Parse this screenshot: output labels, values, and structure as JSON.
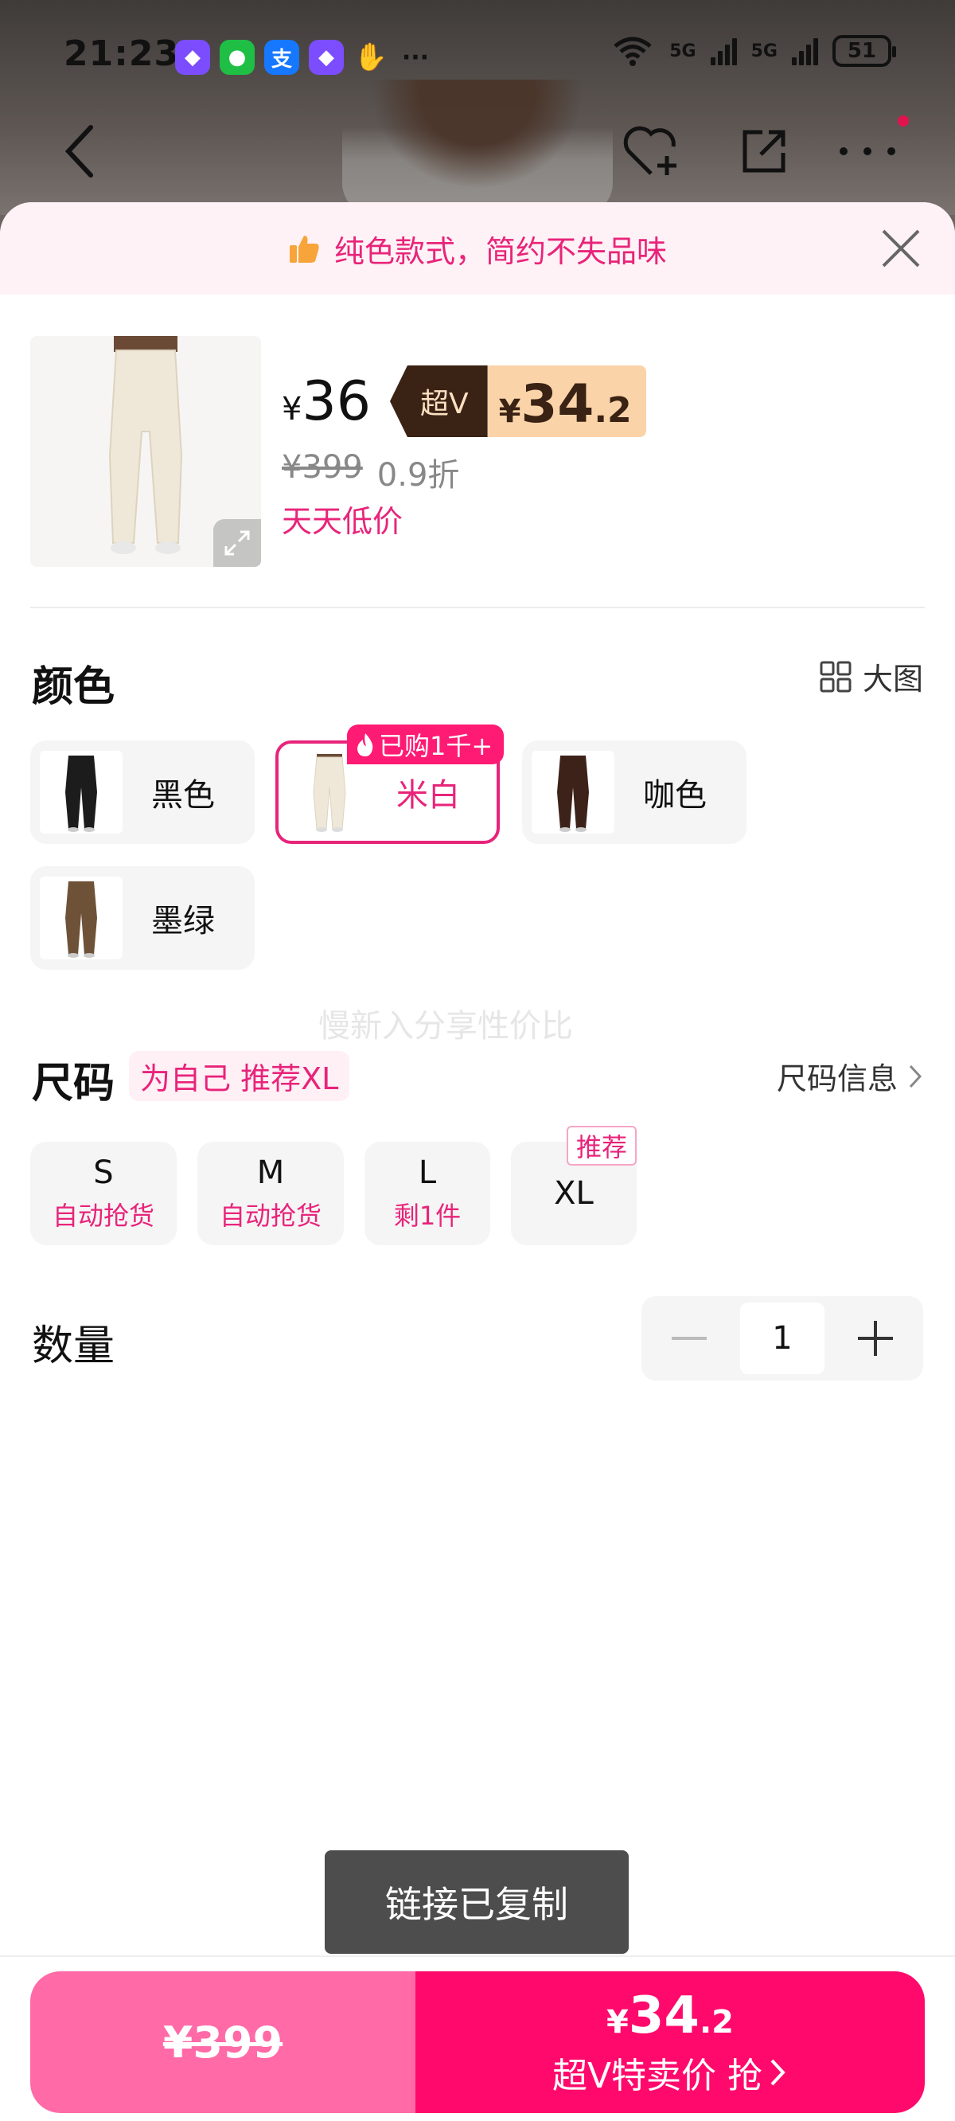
{
  "status_bar": {
    "time": "21:23",
    "network_1": "5G",
    "network_2": "5G",
    "battery": "51"
  },
  "promo": {
    "text": "纯色款式，简约不失品味"
  },
  "product": {
    "price": "36",
    "currency": "¥",
    "super_v_tag": "超V",
    "super_v_price_int": "34",
    "super_v_price_dec": ".2",
    "original_price": "¥399",
    "discount": "0.9折",
    "daily_low": "天天低价"
  },
  "color_section": {
    "title": "颜色",
    "big_image_label": "大图",
    "options": [
      {
        "label": "黑色",
        "selected": false
      },
      {
        "label": "米白",
        "selected": true,
        "badge": "已购1千+"
      },
      {
        "label": "咖色",
        "selected": false
      },
      {
        "label": "墨绿",
        "selected": false
      }
    ]
  },
  "watermark": "慢新入分享性价比",
  "size_section": {
    "title": "尺码",
    "recommend_tag": "为自己 推荐XL",
    "info_link": "尺码信息",
    "options": [
      {
        "name": "S",
        "sub": "自动抢货"
      },
      {
        "name": "M",
        "sub": "自动抢货"
      },
      {
        "name": "L",
        "sub": "剩1件"
      },
      {
        "name": "XL",
        "sub": "",
        "badge": "推荐"
      }
    ]
  },
  "quantity": {
    "title": "数量",
    "value": "1"
  },
  "toast": "链接已复制",
  "bottom_bar": {
    "left_price": "¥399",
    "right_currency": "¥",
    "right_price_int": "34",
    "right_price_dec": ".2",
    "right_label": "超V特卖价 抢"
  },
  "colors": {
    "accent": "#e8247a",
    "accent_button": "#ff0a6c",
    "left_button": "#ff6aa7",
    "super_v_dark": "#3a2214",
    "super_v_light": "#fad3a8"
  }
}
